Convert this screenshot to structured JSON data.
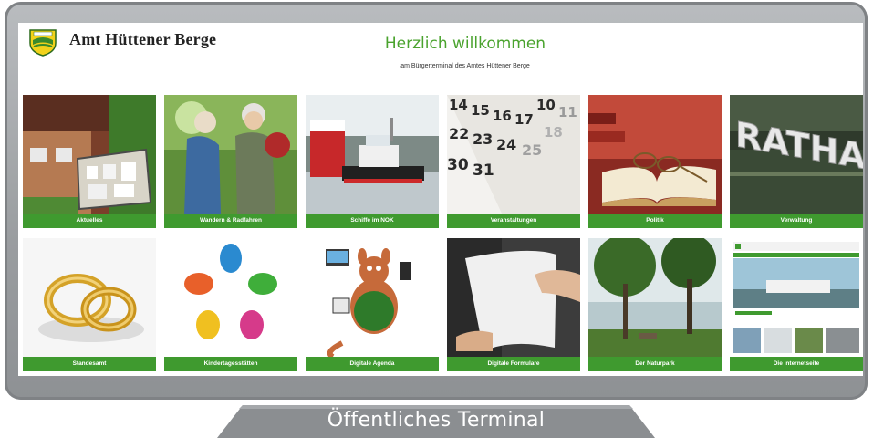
{
  "header": {
    "brand": "Amt Hüttener Berge",
    "welcome": "Herzlich willkommen",
    "subline": "am Bürgerterminal des Amtes Hüttener Berge"
  },
  "tiles": [
    {
      "label": "Aktuelles",
      "image": "notice-board-photo"
    },
    {
      "label": "Wandern & Radfahren",
      "image": "hikers-photo"
    },
    {
      "label": "Schiffe im NOK",
      "image": "ships-photo"
    },
    {
      "label": "Veranstaltungen",
      "image": "calendar-photo"
    },
    {
      "label": "Politik",
      "image": "book-glasses-photo"
    },
    {
      "label": "Verwaltung",
      "image": "rathaus-sign-photo"
    },
    {
      "label": "Standesamt",
      "image": "wedding-rings-photo"
    },
    {
      "label": "Kindertagesstätten",
      "image": "colorful-hands-graphic"
    },
    {
      "label": "Digitale Agenda",
      "image": "cartoon-mascot-graphic"
    },
    {
      "label": "Digitale Formulare",
      "image": "paper-handover-photo"
    },
    {
      "label": "Der Naturpark",
      "image": "lake-forest-photo"
    },
    {
      "label": "Die Internetseite",
      "image": "website-screenshot"
    }
  ],
  "footer": {
    "label": "Öffentliches Terminal"
  },
  "colors": {
    "accent_green": "#3f9a2f",
    "welcome_green": "#4aa32e",
    "bezel_gray": "#9a9da0"
  }
}
